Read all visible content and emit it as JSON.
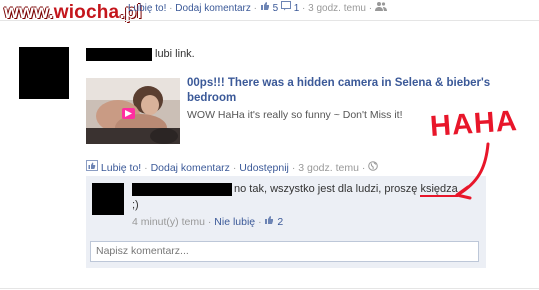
{
  "site": {
    "watermark_prefix": "www.",
    "watermark_red": "wiocha",
    "watermark_suffix": ".pl"
  },
  "prev_post": {
    "like": "Lubię to!",
    "comment": "Dodaj komentarz",
    "likes_count": "5",
    "comments_count": "1",
    "time": "3 godz. temu"
  },
  "post": {
    "likes_link": "lubi link.",
    "link_title": "00ps!!! There was a hidden camera in Selena & bieber's bedroom",
    "link_desc": "WOW HaHa it's really so funny ~ Don't Miss it!",
    "actions": {
      "like": "Lubię to!",
      "comment": "Dodaj komentarz",
      "share": "Udostępnij",
      "time": "3 godz. temu"
    }
  },
  "comment": {
    "text_line1": "no tak, wszystko jest dla ludzi, proszę ",
    "text_link": "księdza",
    "text_line2": ";)",
    "time": "4 minut(y) temu",
    "unlike": "Nie lubię",
    "likes": "2"
  },
  "input": {
    "placeholder": "Napisz komentarz..."
  },
  "annotation": {
    "text": "HAHA",
    "color": "#e8162a"
  },
  "colors": {
    "link": "#3b5998",
    "comment_bg": "#eceff5"
  }
}
